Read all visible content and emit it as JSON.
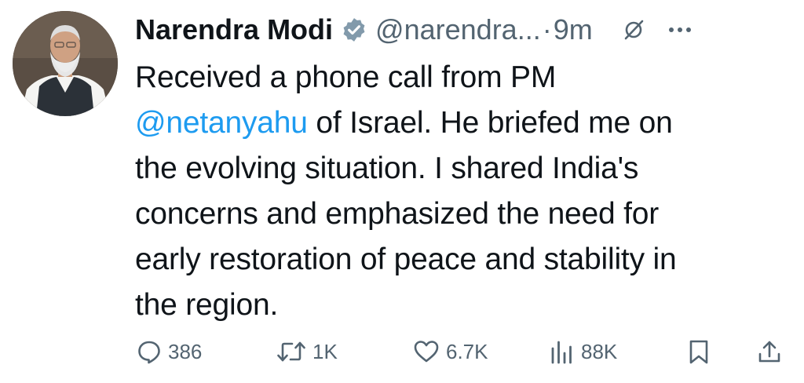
{
  "post": {
    "author_name": "Narendra Modi",
    "handle": "@narendra...",
    "separator": "·",
    "time": "9m",
    "text_before": "Received a phone call from PM\n",
    "mention": "@netanyahu",
    "text_after": " of Israel. He briefed me on\nthe evolving situation. I shared India's\nconcerns and emphasized the need for\nearly restoration of peace and stability in\nthe region."
  },
  "actions": {
    "replies": "386",
    "reposts": "1K",
    "likes": "6.7K",
    "views": "88K"
  },
  "icons": {
    "verified": "verified-badge-icon",
    "grok": "grok-icon",
    "more": "more-icon",
    "reply": "reply-icon",
    "repost": "repost-icon",
    "like": "heart-icon",
    "views": "views-icon",
    "bookmark": "bookmark-icon",
    "share": "share-icon"
  },
  "colors": {
    "text": "#0f1419",
    "secondary": "#536471",
    "link": "#1d9bf0",
    "verified": "#829aab"
  }
}
